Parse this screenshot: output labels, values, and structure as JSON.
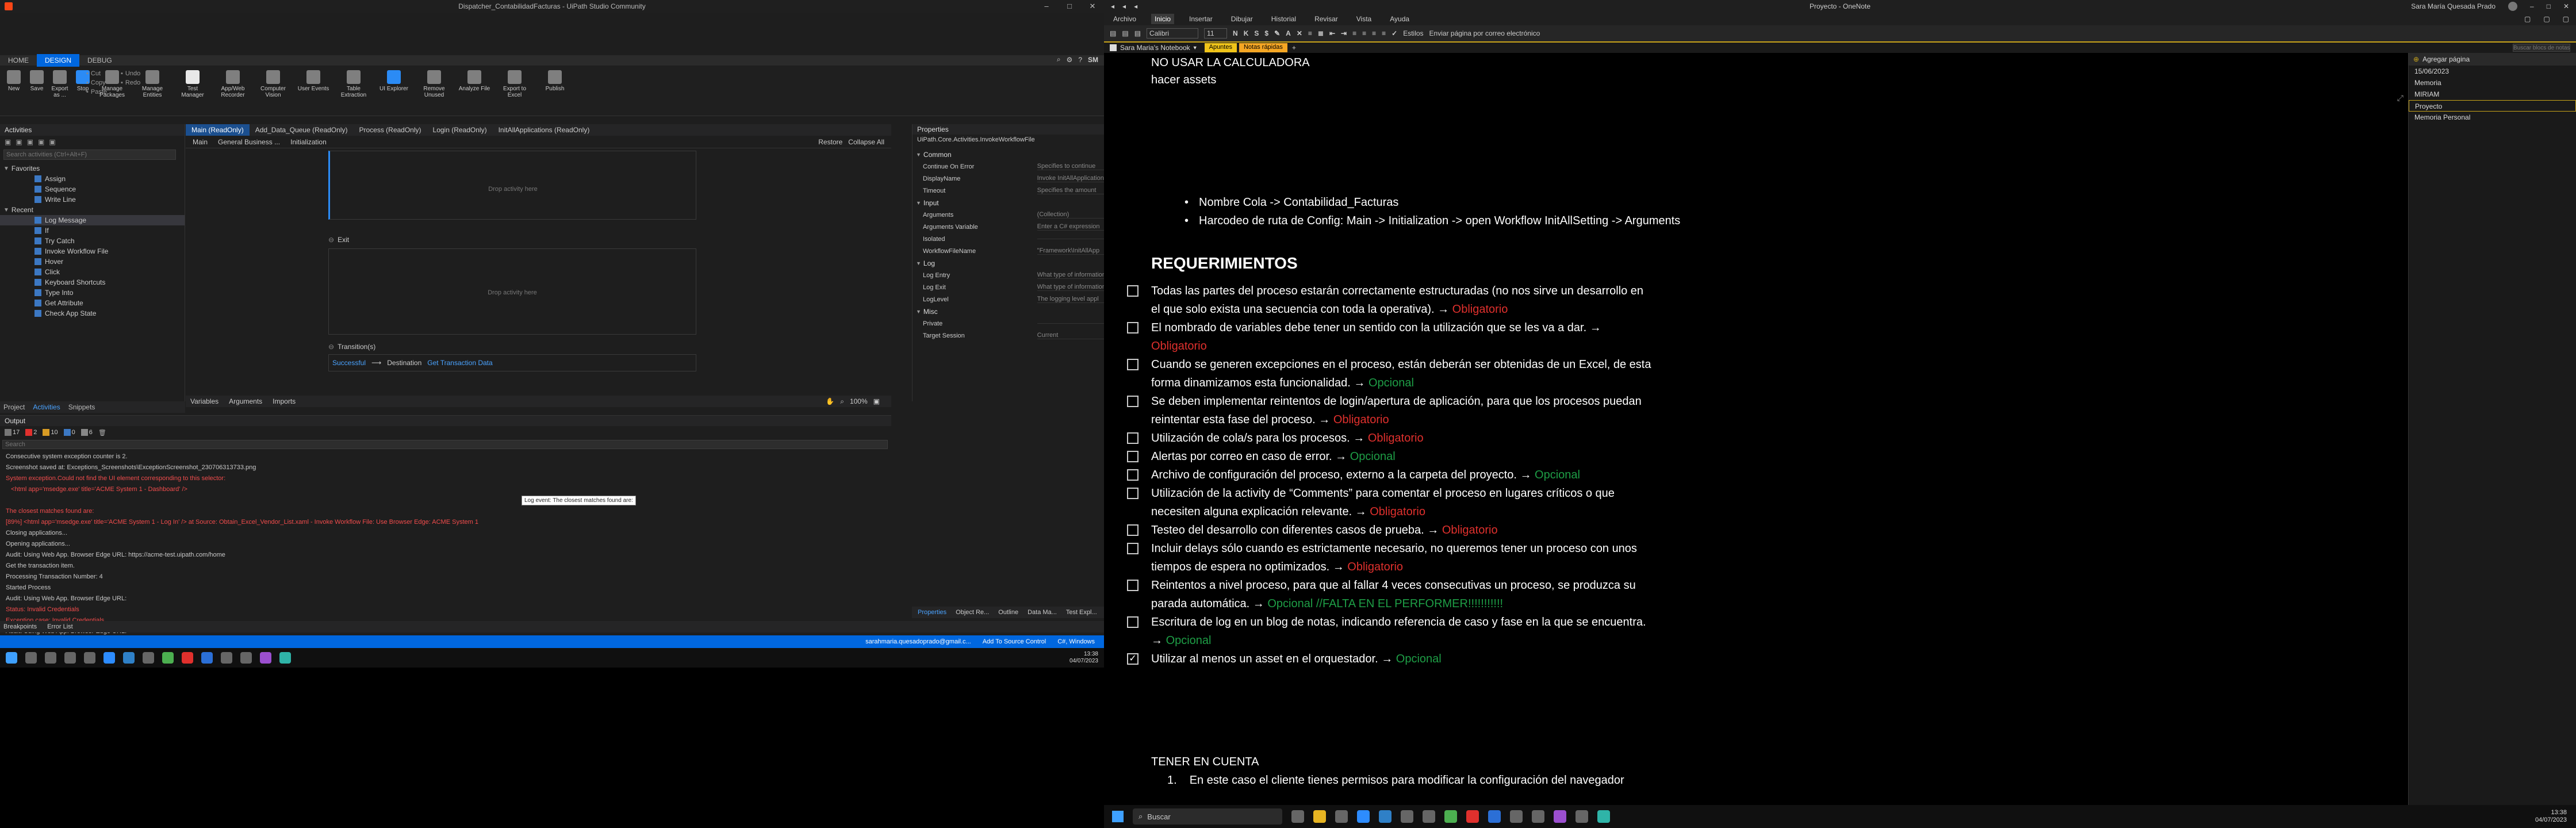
{
  "uipath": {
    "window_title": "Dispatcher_ContabilidadFacturas - UiPath Studio Community",
    "ribbon_tabs": [
      "HOME",
      "DESIGN",
      "DEBUG"
    ],
    "user_initials": "SM",
    "ribbon_buttons": [
      {
        "label": "New",
        "icon": "new-icon"
      },
      {
        "label": "Save",
        "icon": "save-icon"
      },
      {
        "label": "Export as ...",
        "icon": "export-icon"
      },
      {
        "label": "Stop",
        "icon": "stop-icon"
      },
      {
        "label": "Cut",
        "icon": "cut-icon"
      },
      {
        "label": "Undo",
        "icon": "undo-icon"
      },
      {
        "label": "Copy",
        "icon": "copy-icon"
      },
      {
        "label": "Redo",
        "icon": "redo-icon"
      },
      {
        "label": "Paste",
        "icon": "paste-icon"
      },
      {
        "label": "Manage Packages",
        "icon": "packages-icon"
      },
      {
        "label": "Manage Entities",
        "icon": "entities-icon"
      },
      {
        "label": "Test Manager",
        "icon": "test-manager-icon"
      },
      {
        "label": "App/Web Recorder",
        "icon": "recorder-icon"
      },
      {
        "label": "Computer Vision",
        "icon": "vision-icon"
      },
      {
        "label": "User Events",
        "icon": "events-icon"
      },
      {
        "label": "Table Extraction",
        "icon": "table-icon"
      },
      {
        "label": "UI Explorer",
        "icon": "ui-explorer-icon"
      },
      {
        "label": "Remove Unused",
        "icon": "remove-icon"
      },
      {
        "label": "Analyze File",
        "icon": "analyze-icon"
      },
      {
        "label": "Export to Excel",
        "icon": "excel-icon"
      },
      {
        "label": "Publish",
        "icon": "publish-icon"
      }
    ],
    "activities_title": "Activities",
    "activities_search_placeholder": "Search activities (Ctrl+Alt+F)",
    "activities_groups": [
      "Favorites",
      "Recent"
    ],
    "favorites": [
      "Assign",
      "Sequence",
      "Write Line"
    ],
    "recent": [
      "Log Message",
      "If",
      "Try Catch",
      "Invoke Workflow File",
      "Hover",
      "Click",
      "Keyboard Shortcuts",
      "Type Into",
      "Get Attribute",
      "Check App State"
    ],
    "left_tabs": [
      "Project",
      "Activities",
      "Snippets"
    ],
    "doc_tabs": [
      "Main (ReadOnly)",
      "Add_Data_Queue (ReadOnly)",
      "Process (ReadOnly)",
      "Login (ReadOnly)",
      "InitAllApplications (ReadOnly)"
    ],
    "breadcrumbs": [
      "Main",
      "General Business ...",
      "Initialization"
    ],
    "restore_label": "Restore",
    "collapse_label": "Collapse All",
    "drop_label": "Drop activity here",
    "exit_label": "Exit",
    "transitions_label": "Transition(s)",
    "transition_status": "Successful",
    "transition_dest_label": "Destination",
    "transition_dest": "Get Transaction Data",
    "bottom_tabs": [
      "Variables",
      "Arguments",
      "Imports"
    ],
    "zoom": "100%",
    "properties_title": "Properties",
    "properties_path": "UiPath.Core.Activities.InvokeWorkflowFile",
    "props": [
      {
        "type": "group",
        "name": "Common"
      },
      {
        "type": "prop",
        "name": "Continue On Error",
        "value": "Specifies to continue"
      },
      {
        "type": "prop",
        "name": "DisplayName",
        "value": "Invoke InitAllApplications.xaml"
      },
      {
        "type": "prop",
        "name": "Timeout",
        "value": "Specifies the amount"
      },
      {
        "type": "group",
        "name": "Input"
      },
      {
        "type": "prop",
        "name": "Arguments",
        "value": "(Collection)"
      },
      {
        "type": "prop",
        "name": "Arguments Variable",
        "value": "Enter a C# expression"
      },
      {
        "type": "prop",
        "name": "Isolated",
        "value": ""
      },
      {
        "type": "prop",
        "name": "WorkflowFileName",
        "value": "\"Framework\\InitAllApp"
      },
      {
        "type": "group",
        "name": "Log"
      },
      {
        "type": "prop",
        "name": "Log Entry",
        "value": "What type of information"
      },
      {
        "type": "prop",
        "name": "Log Exit",
        "value": "What type of information"
      },
      {
        "type": "prop",
        "name": "LogLevel",
        "value": "The logging level appl"
      },
      {
        "type": "group",
        "name": "Misc"
      },
      {
        "type": "prop",
        "name": "Private",
        "value": ""
      },
      {
        "type": "prop",
        "name": "Target Session",
        "value": "Current"
      }
    ],
    "prop_tabs": [
      "Properties",
      "Object Re...",
      "Outline",
      "Data Ma...",
      "Test Expl..."
    ],
    "output_title": "Output",
    "output_counts": [
      "17",
      "2",
      "10",
      "0",
      "6"
    ],
    "output_search_placeholder": "Search",
    "output_lines": [
      {
        "t": "Consecutive system exception counter is 2.",
        "c": "#c8c8c8"
      },
      {
        "t": "Screenshot saved at: Exceptions_Screenshots\\ExceptionScreenshot_230706313733.png",
        "c": "#c8c8c8"
      },
      {
        "t": "System exception.Could not find the UI element corresponding to this selector:",
        "c": "#f14c4c"
      },
      {
        "t": "   <html app='msedge.exe' title='ACME System 1 - Dashboard' />",
        "c": "#f14c4c"
      },
      {
        "t": "",
        "c": "#c8c8c8"
      },
      {
        "t": "The closest matches found are:",
        "c": "#f14c4c"
      },
      {
        "t": "[89%] <html app='msedge.exe' title='ACME System 1 - Log In' /> at Source: Obtain_Excel_Vendor_List.xaml - Invoke Workflow File: Use Browser Edge: ACME System 1",
        "c": "#f14c4c"
      },
      {
        "t": "Closing applications...",
        "c": "#c8c8c8"
      },
      {
        "t": "Opening applications...",
        "c": "#c8c8c8"
      },
      {
        "t": "Audit: Using Web App. Browser Edge URL: https://acme-test.uipath.com/home",
        "c": "#c8c8c8"
      },
      {
        "t": "Get the transaction item.",
        "c": "#c8c8c8"
      },
      {
        "t": "Processing Transaction Number: 4",
        "c": "#c8c8c8"
      },
      {
        "t": "Started Process",
        "c": "#c8c8c8"
      },
      {
        "t": "Audit: Using Web App. Browser Edge URL:",
        "c": "#c8c8c8"
      },
      {
        "t": "Status: Invalid Credentials",
        "c": "#f14c4c"
      },
      {
        "t": "Exception case: Invalid Credentials",
        "c": "#f14c4c"
      },
      {
        "t": "Audit: Using Web App. Browser Edge URL:",
        "c": "#c8c8c8"
      }
    ],
    "tooltip": "Log event: The closest matches found are:",
    "footer_tabs": [
      "Breakpoints",
      "Error List"
    ],
    "status_user": "sarahmaria.quesadoprado@gmail.c...",
    "status_source": "Add To Source Control",
    "status_lang": "C#, Windows",
    "taskbar_time": "13:38",
    "taskbar_date": "04/07/2023"
  },
  "onenote": {
    "title": "Proyecto - OneNote",
    "user_name": "Sara María Quesada Prado",
    "menu": [
      "Archivo",
      "Inicio",
      "Insertar",
      "Dibujar",
      "Historial",
      "Revisar",
      "Vista",
      "Ayuda"
    ],
    "font_name": "Calibri",
    "font_size": "11",
    "editing_label": "Estilos",
    "email_label": "Enviar página por correo electrónico",
    "notebook": "Sara Maria's Notebook",
    "sections": [
      "Apuntes",
      "Notas rápidas"
    ],
    "search_placeholder": "Buscar blocs de notas",
    "add_page": "Agregar página",
    "pages": [
      "15/06/2023",
      "Memoria",
      "MIRIAM",
      "Proyecto",
      "Memoria Personal"
    ],
    "header_lines": [
      "NO USAR LA CALCULADORA",
      "hacer assets"
    ],
    "bullets": [
      "Nombre Cola -> Contabilidad_Facturas",
      "Harcodeo de ruta de Config: Main -> Initialization -> open Workflow InitAllSetting -> Arguments"
    ],
    "requirements_title": "REQUERIMIENTOS",
    "requirements": [
      {
        "lines": [
          "Todas las partes del proceso estarán correctamente estructuradas (no nos sirve un desarrollo en",
          "el que solo exista una secuencia con toda la operativa). → "
        ],
        "tag": "Obligatorio",
        "tc": "#e0302d",
        "check": false
      },
      {
        "lines": [
          "El nombrado de variables debe tener un sentido con la utilización que se les va a dar. →",
          ""
        ],
        "tag": "Obligatorio",
        "tc": "#e0302d",
        "check": false
      },
      {
        "lines": [
          "Cuando se generen excepciones en el proceso, están deberán ser obtenidas de un Excel, de esta",
          "forma dinamizamos esta funcionalidad. → "
        ],
        "tag": "Opcional",
        "tc": "#1e9e46",
        "check": false
      },
      {
        "lines": [
          "Se deben implementar reintentos de login/apertura de aplicación, para que los procesos puedan",
          "reintentar esta fase del proceso. → "
        ],
        "tag": "Obligatorio",
        "tc": "#e0302d",
        "check": false
      },
      {
        "lines": [
          "Utilización de cola/s para los procesos. → "
        ],
        "tag": "Obligatorio",
        "tc": "#e0302d",
        "check": false
      },
      {
        "lines": [
          " Alertas por correo en caso de error. → "
        ],
        "tag": "Opcional",
        "tc": "#1e9e46",
        "check": false
      },
      {
        "lines": [
          " Archivo de configuración del proceso, externo a la carpeta del proyecto. → "
        ],
        "tag": "Opcional",
        "tc": "#1e9e46",
        "check": false
      },
      {
        "lines": [
          "Utilización de la activity de “Comments” para comentar el proceso en lugares críticos o que",
          "necesiten alguna explicación relevante. → "
        ],
        "tag": "Obligatorio",
        "tc": "#e0302d",
        "check": false
      },
      {
        "lines": [
          "Testeo del desarrollo con diferentes casos de prueba. → "
        ],
        "tag": "Obligatorio",
        "tc": "#e0302d",
        "check": false
      },
      {
        "lines": [
          "Incluir delays sólo cuando es estrictamente necesario, no queremos tener un proceso con unos",
          "tiempos de espera no optimizados. → "
        ],
        "tag": "Obligatorio",
        "tc": "#e0302d",
        "check": false
      },
      {
        "lines": [
          "Reintentos a nivel proceso, para que al fallar 4 veces consecutivas un proceso, se produzca su",
          "parada automática. → "
        ],
        "tag": "Opcional //FALTA EN EL PERFORMER!!!!!!!!!!!",
        "tc": "#1e9e46",
        "check": false
      },
      {
        "lines": [
          "Escritura de log en un blog de notas, indicando referencia de caso y fase en la que se encuentra.",
          "→ "
        ],
        "tag": "Opcional",
        "tc": "#1e9e46",
        "check": false
      },
      {
        "lines": [
          " Utilizar al menos un asset en el orquestador. → "
        ],
        "tag": "Opcional",
        "tc": "#1e9e46",
        "check": true
      }
    ],
    "footer_title": "TENER EN CUENTA",
    "footer_item_num": "1.",
    "footer_item": "En este caso el cliente tienes permisos para modificar la configuración del navegador",
    "taskbar_search": "Buscar",
    "taskbar_time": "13:38",
    "taskbar_date": "04/07/2023"
  }
}
